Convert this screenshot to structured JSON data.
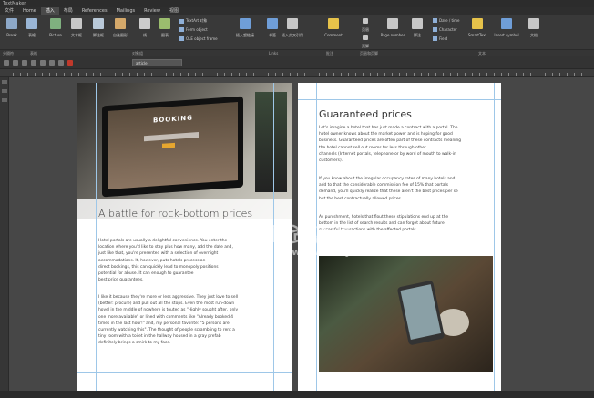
{
  "titlebar": {
    "app": "TextMaker"
  },
  "menu": [
    {
      "label": "文件",
      "active": false
    },
    {
      "label": "Home",
      "active": false
    },
    {
      "label": "插入",
      "active": true
    },
    {
      "label": "布局",
      "active": false
    },
    {
      "label": "References",
      "active": false
    },
    {
      "label": "Mailings",
      "active": false
    },
    {
      "label": "Review",
      "active": false
    },
    {
      "label": "视图",
      "active": false
    }
  ],
  "ribbon": {
    "big": [
      {
        "label": "Break",
        "icon": "break-icon",
        "color": "#8da8c8"
      },
      {
        "label": "表格",
        "icon": "table-icon",
        "color": "#9ab6d6"
      },
      {
        "label": "Picture",
        "icon": "picture-icon",
        "color": "#7fb07f"
      },
      {
        "label": "文本框",
        "icon": "textbox-icon",
        "color": "#c7c7c7"
      },
      {
        "label": "脚注框",
        "icon": "frame-icon",
        "color": "#b9c9d9"
      },
      {
        "label": "自选图形",
        "icon": "shapes-icon",
        "color": "#d4a86a"
      },
      {
        "label": "线",
        "icon": "line-icon",
        "color": "#cccccc"
      },
      {
        "label": "图表",
        "icon": "chart-icon",
        "color": "#9bbd6e"
      }
    ],
    "small": [
      {
        "label": "TextArt 对象",
        "icon": "textart-icon"
      },
      {
        "label": "Form object",
        "icon": "form-icon"
      },
      {
        "label": "OLE object frame",
        "icon": "ole-icon"
      },
      {
        "label": "Date / time",
        "icon": "date-icon"
      },
      {
        "label": "Character",
        "icon": "character-icon"
      },
      {
        "label": "Field",
        "icon": "field-icon"
      }
    ],
    "mid": [
      {
        "label": "插入超链接",
        "icon": "hyperlink-icon",
        "color": "#6f9ed8"
      },
      {
        "label": "书签",
        "icon": "bookmark-icon",
        "color": "#6f9ed8"
      },
      {
        "label": "插入交叉引用",
        "icon": "crossref-icon",
        "color": "#c7c7c7"
      },
      {
        "label": "Comment",
        "icon": "comment-icon",
        "color": "#e6c24a"
      },
      {
        "label": "页眉",
        "icon": "header-icon",
        "color": "#c7c7c7"
      },
      {
        "label": "页脚",
        "icon": "footer-icon",
        "color": "#c7c7c7"
      },
      {
        "label": "Page number",
        "icon": "page-number-icon",
        "color": "#c7c7c7"
      },
      {
        "label": "脚注",
        "icon": "footnote-icon",
        "color": "#c7c7c7"
      },
      {
        "label": "SmartText",
        "icon": "smarttext-icon",
        "color": "#e6c24a"
      },
      {
        "label": "Insert symbol",
        "icon": "symbol-icon",
        "color": "#6f9ed8"
      },
      {
        "label": "文档",
        "icon": "document-icon",
        "color": "#c7c7c7"
      }
    ],
    "groups": [
      "分隔符",
      "表格",
      "对象组",
      "Links",
      "批注",
      "页眉和页脚",
      "文本"
    ]
  },
  "toolbar": {
    "style_field": "article"
  },
  "page1": {
    "hero_label": "BOOKING",
    "heading": "A battle for rock-bottom prices",
    "para1": "Hotel portals are usually a delightful convenience. You enter the\nlocation where you'd like to stay plus how many, add the date and,\njust like that, you're presented with a selection of overnight\naccommodations. It, however, puts hotels process an\ndirect bookings, this can quickly lead to monopoly positions\npotential for abuse. It can enough to guarantee\nbest price guarantees.",
    "para2": "I like it because they're more or less aggressive. They just love to sell\n(better: procure) and pull out all the stops. Even the most run-down\nhovel in the middle of nowhere is touted as \"Highly sought after, only\none more available\" or lined with comments like \"Already booked 4\ntimes in the last hour!\" and, my personal favorite: \"5 persons are\ncurrently watching this\". The thought of people scrambling to rent a\ntiny room with a toilet in the hallway housed in a gray prefab\ndefinitely brings a smirk to my face."
  },
  "page2": {
    "heading": "Guaranteed prices",
    "para1": "Let's imagine a hotel that has just made a contract with a portal. The\nhotel owner knows about the market power and is hoping for good\nbusiness. Guaranteed prices are often part of these contracts meaning\nthe hotel cannot sell out rooms for less through other\nchannels (Internet portals, telephone or by word of mouth to walk-in\ncustomers).",
    "para2": "If you know about the irregular occupancy rates of many hotels and\nadd to that the considerable commission fee of 15% that portals\ndemand, you'll quickly realize that these aren't the best prices per se\nbut the best contractually allowed prices.",
    "para3": "As punishment, hotels that flout these stipulations end up at the\nbottom in the list of search results and can forget about future\nsuccessful transactions with the affected portals."
  },
  "watermark": {
    "line1": "数码资源网",
    "line2": "www.smzy.com"
  }
}
